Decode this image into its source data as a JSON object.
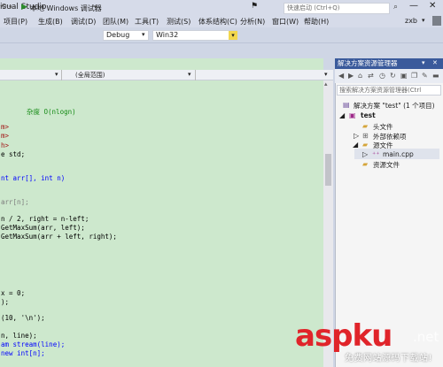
{
  "titlebar": {
    "title": "isual Studio",
    "notification_icon": "flag-icon",
    "quicklaunch_placeholder": "快速启动 (Ctrl+Q)",
    "minimize_glyph": "—",
    "close_glyph": "✕"
  },
  "menu": {
    "items": [
      "项目(P)",
      "生成(B)",
      "调试(D)",
      "团队(M)",
      "工具(T)",
      "测试(S)",
      "体系结构(C)",
      "分析(N)",
      "窗口(W)",
      "帮助(H)"
    ],
    "user": "zxb",
    "user_dropdown": "▾"
  },
  "toolbar": {
    "run_label": "本地 Windows 调试器",
    "configuration": "Debug",
    "platform": "Win32"
  },
  "navbar": {
    "member_scope": "(全局范围)"
  },
  "code_lines": [
    "杂度 O(nlogn)",
    "m>",
    "m>",
    "h>",
    "e std;",
    "nt arr[], int n)",
    "arr[n];",
    "n / 2, right = n-left;",
    "GetMaxSum(arr, left);",
    "GetMaxSum(arr + left, right);",
    "x = 0;",
    ");",
    "(10, '\\n');",
    "n, line);",
    "am stream(line);",
    "new int[n];"
  ],
  "solution_explorer": {
    "title": "解决方案资源管理器",
    "search_placeholder": "搜索解决方案资源管理器(Ctrl",
    "tree": {
      "solution": "解决方案 \"test\" (1 个项目)",
      "project": "test",
      "header_files": "头文件",
      "external_deps": "外部依赖项",
      "source_files": "源文件",
      "main_cpp": "main.cpp",
      "resource_files": "资源文件"
    }
  },
  "watermark": {
    "brand": "aspku",
    "suffix": ".net",
    "subtitle": "免费网站源码下载站!"
  }
}
